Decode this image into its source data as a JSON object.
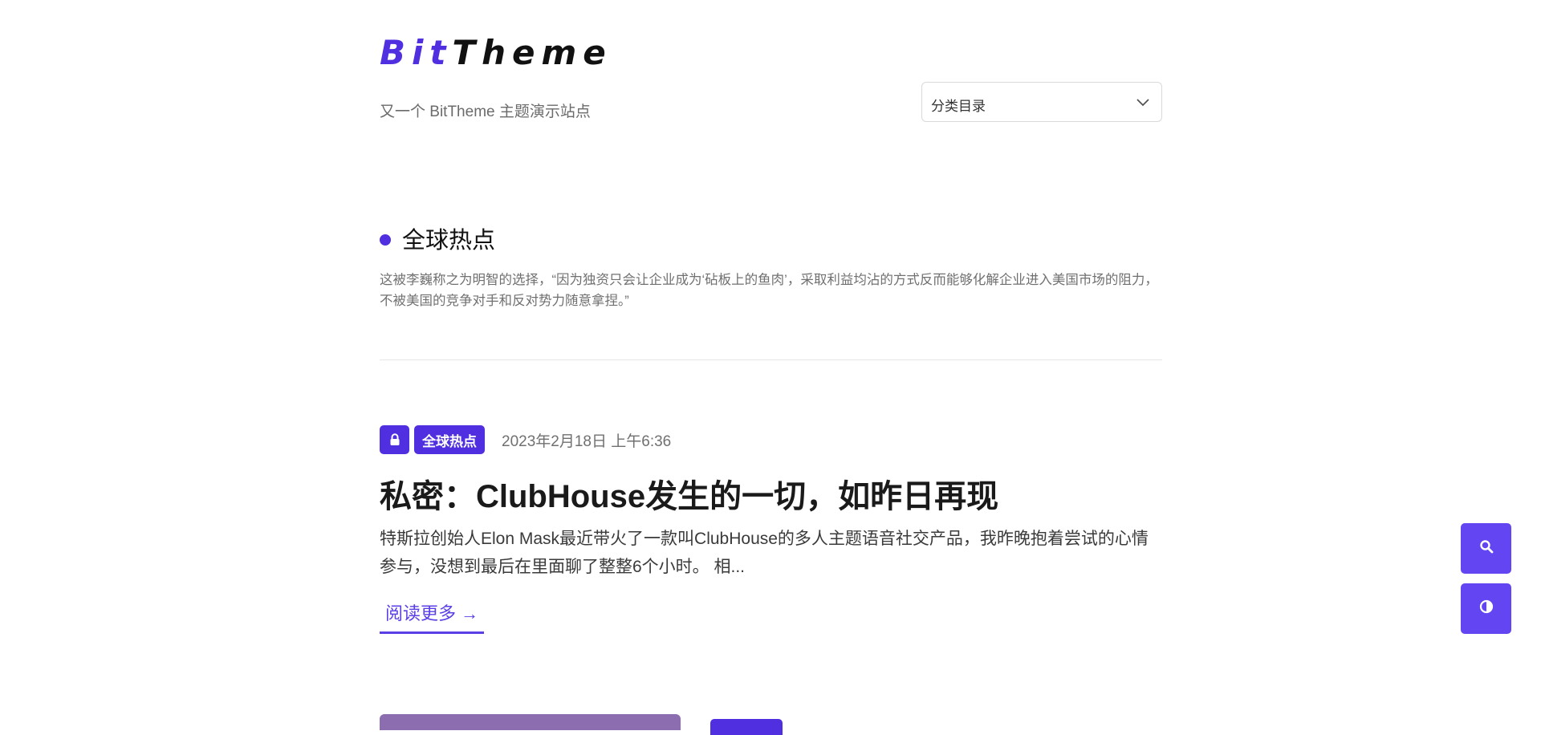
{
  "site": {
    "logo_bit": "Bit",
    "logo_theme": "Theme",
    "tagline": "又一个 BitTheme 主题演示站点"
  },
  "category_select": {
    "label": "分类目录",
    "icon": "chevron-down-icon"
  },
  "category": {
    "title": "全球热点",
    "description": "这被李巍称之为明智的选择，“因为独资只会让企业成为‘砧板上的鱼肉’，采取利益均沾的方式反而能够化解企业进入美国市场的阻力，不被美国的竞争对手和反对势力随意拿捏。”"
  },
  "post": {
    "lock_icon": "lock-icon",
    "category_badge": "全球热点",
    "date": "2023年2月18日 上午6:36",
    "title": "私密：ClubHouse发生的一切，如昨日再现",
    "excerpt": "特斯拉创始人Elon Mask最近带火了一款叫ClubHouse的多人主题语音社交产品，我昨晚抱着尝试的心情参与，没想到最后在里面聊了整整6个小时。 相...",
    "read_more": "阅读更多 →"
  },
  "floating": {
    "search_icon": "search-icon",
    "theme_icon": "contrast-icon"
  },
  "colors": {
    "accent": "#4f2fe0",
    "float_button": "#6445f2",
    "read_more": "#5b3fe6"
  }
}
